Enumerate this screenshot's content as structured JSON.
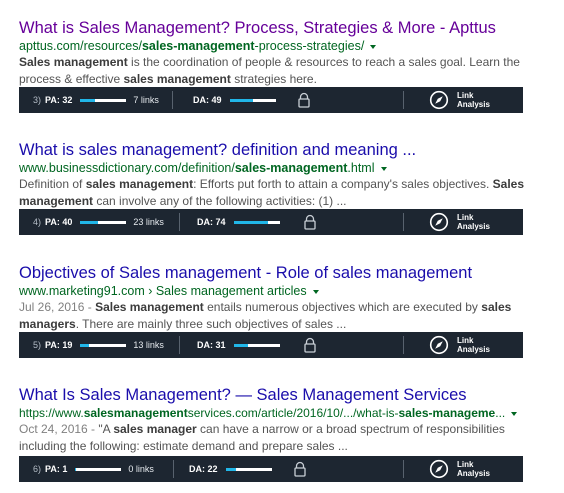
{
  "results": [
    {
      "title": "What is Sales Management? Process, Strategies & More - Apttus",
      "url_pre": "apttus.com/resources/",
      "url_bold": "sales-management",
      "url_post": "-process-strategies/",
      "snippet": [
        {
          "t": "Sales management",
          "b": true
        },
        {
          "t": " is the coordination of people & resources to reach a sales goal. Learn the process & effective ",
          "b": false
        },
        {
          "t": "sales management",
          "b": true
        },
        {
          "t": " strategies here.",
          "b": false
        }
      ],
      "bar": {
        "rank": "3)",
        "pa_label": "PA: 32",
        "pa_value": 32,
        "links": "7 links",
        "da_label": "DA: 49",
        "da_value": 49,
        "la_line1": "Link",
        "la_line2": "Analysis"
      }
    },
    {
      "title": "What is sales management? definition and meaning ...",
      "url_pre": "www.businessdictionary.com/definition/",
      "url_bold": "sales-management",
      "url_post": ".html",
      "snippet": [
        {
          "t": "Definition of ",
          "b": false
        },
        {
          "t": "sales management",
          "b": true
        },
        {
          "t": ": Efforts put forth to attain a company's sales objectives. ",
          "b": false
        },
        {
          "t": "Sales management",
          "b": true
        },
        {
          "t": " can involve any of the following activities: (1) ...",
          "b": false
        }
      ],
      "bar": {
        "rank": "4)",
        "pa_label": "PA: 40",
        "pa_value": 40,
        "links": "23 links",
        "da_label": "DA: 74",
        "da_value": 74,
        "la_line1": "Link",
        "la_line2": "Analysis"
      }
    },
    {
      "title": "Objectives of Sales management - Role of sales management",
      "url_pre": "www.marketing91.com › Sales management articles",
      "url_bold": "",
      "url_post": "",
      "snippet": [
        {
          "t": "Jul 26, 2016 - ",
          "b": false,
          "date": true
        },
        {
          "t": "Sales management",
          "b": true
        },
        {
          "t": " entails numerous objectives which are executed by ",
          "b": false
        },
        {
          "t": "sales managers",
          "b": true
        },
        {
          "t": ". There are mainly three such objectives of sales ...",
          "b": false
        }
      ],
      "bar": {
        "rank": "5)",
        "pa_label": "PA: 19",
        "pa_value": 19,
        "links": "13 links",
        "da_label": "DA: 31",
        "da_value": 31,
        "la_line1": "Link",
        "la_line2": "Analysis"
      }
    },
    {
      "title": "What Is Sales Management? — Sales Management Services",
      "url_pre": "https://www.",
      "url_bold": "salesmanagement",
      "url_post": "services.com/article/2016/10/.../what-is-",
      "url_bold2": "sales-manageme",
      "url_post2": "...",
      "snippet": [
        {
          "t": "Oct 24, 2016 - ",
          "b": false,
          "date": true
        },
        {
          "t": "\"A ",
          "b": false
        },
        {
          "t": "sales manager",
          "b": true
        },
        {
          "t": " can have a narrow or a broad spectrum of responsibilities including the following: estimate demand and prepare sales ...",
          "b": false
        }
      ],
      "bar": {
        "rank": "6)",
        "pa_label": "PA: 1",
        "pa_value": 1,
        "links": "0 links",
        "da_label": "DA: 22",
        "da_value": 22,
        "la_line1": "Link",
        "la_line2": "Analysis"
      }
    }
  ],
  "icons": {
    "lock": "lock-icon",
    "compass": "compass-icon"
  },
  "colors": {
    "title_link": "#1a0dab",
    "title_visited": "#660099",
    "url": "#006621",
    "bar_bg": "#1d2631",
    "meter_fill": "#21b6e8"
  }
}
